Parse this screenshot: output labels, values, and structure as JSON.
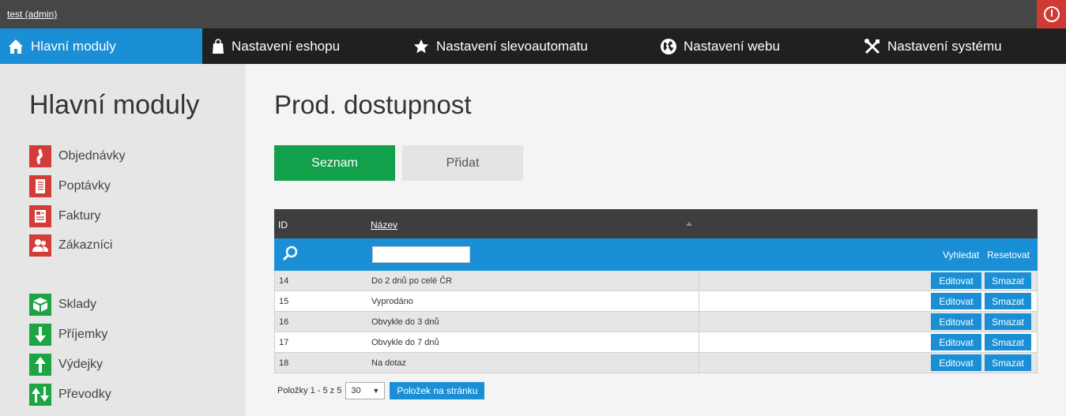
{
  "topbar": {
    "user": "test (admin)",
    "logout_icon": "power-icon"
  },
  "nav": [
    {
      "label": "Hlavní moduly",
      "icon": "home-icon"
    },
    {
      "label": "Nastavení eshopu",
      "icon": "shopping-bag-icon"
    },
    {
      "label": "Nastavení slevoautomatu",
      "icon": "star-icon"
    },
    {
      "label": "Nastavení webu",
      "icon": "globe-icon"
    },
    {
      "label": "Nastavení systému",
      "icon": "tools-icon"
    }
  ],
  "sidebar": {
    "title": "Hlavní moduly",
    "items": [
      {
        "label": "Objednávky",
        "icon": "order-icon",
        "color": "#d43c3a"
      },
      {
        "label": "Poptávky",
        "icon": "notebook-icon",
        "color": "#d43c3a"
      },
      {
        "label": "Faktury",
        "icon": "invoice-icon",
        "color": "#d43c3a"
      },
      {
        "label": "Zákazníci",
        "icon": "customers-icon",
        "color": "#d43c3a"
      },
      {
        "label": "Sklady",
        "icon": "warehouse-icon",
        "color": "#1da443"
      },
      {
        "label": "Příjemky",
        "icon": "arrow-down-icon",
        "color": "#1da443"
      },
      {
        "label": "Výdejky",
        "icon": "arrow-up-icon",
        "color": "#1da443"
      },
      {
        "label": "Převodky",
        "icon": "transfer-icon",
        "color": "#1da443"
      }
    ]
  },
  "page": {
    "title": "Prod. dostupnost",
    "tabs": {
      "list": "Seznam",
      "add": "Přidat"
    }
  },
  "grid": {
    "columns": {
      "id": "ID",
      "name": "Název"
    },
    "filter": {
      "search_label": "Vyhledat",
      "reset_label": "Resetovat",
      "value": ""
    },
    "edit_label": "Editovat",
    "delete_label": "Smazat",
    "rows": [
      {
        "id": "14",
        "name": "Do 2 dnů po celé ČR"
      },
      {
        "id": "15",
        "name": "Vyprodáno"
      },
      {
        "id": "16",
        "name": "Obvykle do 3 dnů"
      },
      {
        "id": "17",
        "name": "Obvykle do 7 dnů"
      },
      {
        "id": "18",
        "name": "Na dotaz"
      }
    ]
  },
  "pager": {
    "info": "Položky 1 - 5 z 5",
    "page_size": "30",
    "button": "Položek na stránku"
  },
  "colors": {
    "accent": "#1a8fd5",
    "nav_bg": "#202020",
    "topbar_bg": "#464646",
    "primary_button": "#12a04b",
    "danger": "#d03a35"
  }
}
